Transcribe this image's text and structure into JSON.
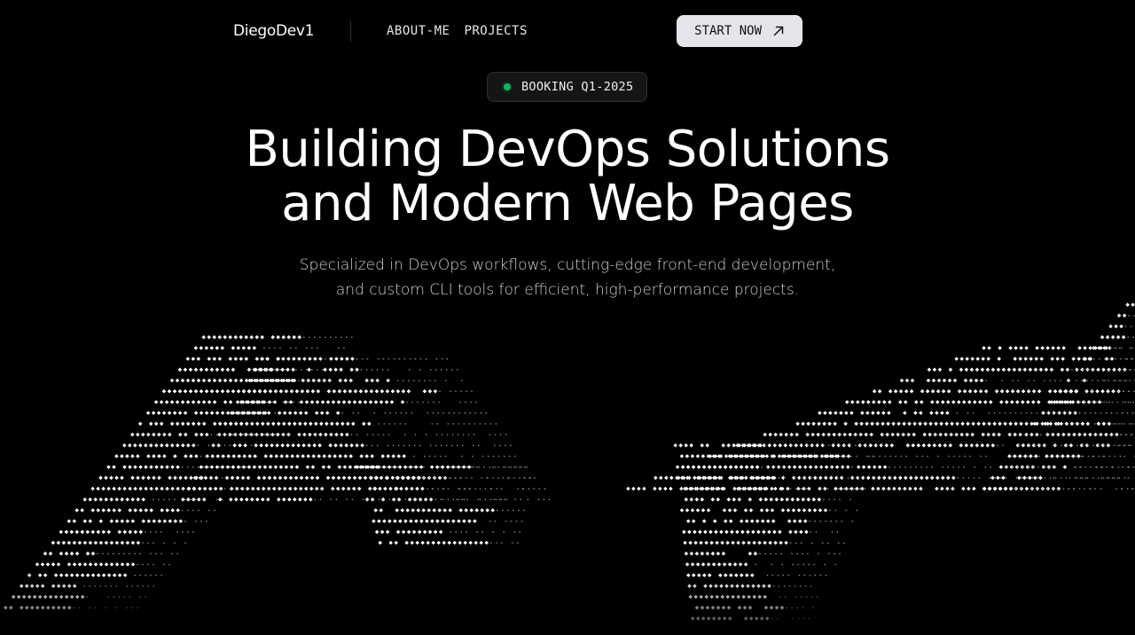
{
  "nav": {
    "logo": "DiegoDev1",
    "links": [
      {
        "label": "ABOUT-ME"
      },
      {
        "label": "PROJECTS"
      }
    ],
    "cta_label": "START NOW",
    "cta_icon": "arrow-up-right-icon"
  },
  "badge": {
    "text": "BOOKING Q1-2025",
    "dot_color": "#10b45c",
    "icon": "status-dot-icon"
  },
  "hero": {
    "title_lines": [
      "Building DevOps Solutions",
      "and Modern Web Pages"
    ],
    "subtitle_lines": [
      "Specialized in DevOps workflows, cutting-edge front-end development,",
      "and custom CLI tools for efficient, high-performance projects."
    ]
  },
  "colors": {
    "background": "#000000",
    "cta_background": "#e4e5ea",
    "ascii_bright": "#ffffff",
    "ascii_dim": "#8a8a8a"
  },
  "decoration": {
    "ascii_art": "hands-ascii-art"
  }
}
